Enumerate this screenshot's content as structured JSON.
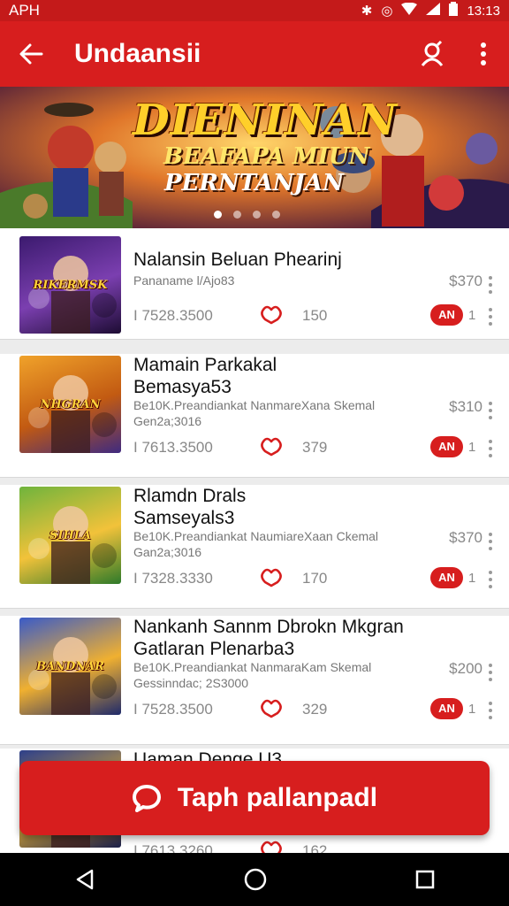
{
  "status_bar": {
    "left_text": "APH",
    "time": "13:13"
  },
  "app_bar": {
    "title": "Undaansii"
  },
  "banner": {
    "line1": "DIENINAN",
    "line2": "BEAFAPA MIUN",
    "line3": "PERNTANJAN",
    "slides": 4,
    "active_slide": 0
  },
  "cards": [
    {
      "title": "Nalansin Beluan Phearinj",
      "title2": "",
      "subtitle": "Pananame l/Ajo83",
      "subtitle2": "",
      "price": "$370",
      "id": "I 7528.3500",
      "count": "150",
      "pill": "AN",
      "badge_num": "1",
      "thumb_label": "RIKERMSK",
      "thumb_colors": [
        "#3b1a6e",
        "#7b3fb0",
        "#1d0c33"
      ]
    },
    {
      "title": "Mamain Parkakal",
      "title2": "Bemasya53",
      "subtitle": "Be10K.Preandiankat NanmareXana Skemal",
      "subtitle2": "Gen2a;3016",
      "price": "$310",
      "id": "I 7613.3500",
      "count": "379",
      "pill": "AN",
      "badge_num": "1",
      "thumb_label": "NHGRAN",
      "thumb_colors": [
        "#f0a22a",
        "#c25a12",
        "#3f2a80"
      ]
    },
    {
      "title": "Rlamdn Drals",
      "title2": "Samseyals3",
      "subtitle": "Be10K.Preandiankat NaumiareXaan Ckemal",
      "subtitle2": "Gan2a;3016",
      "price": "$370",
      "id": "I 7328.3330",
      "count": "170",
      "pill": "AN",
      "badge_num": "1",
      "thumb_label": "SIHLA",
      "thumb_colors": [
        "#6fb43c",
        "#f2c23a",
        "#2e7a2a"
      ]
    },
    {
      "title": "Nankanh Sannm Dbrokn Mkgran",
      "title2": "Gatlaran Plenarba3",
      "subtitle": "Be10K.Preandiankat NanmaraKam Skemal",
      "subtitle2": "Gessinndac; 2S3000",
      "price": "$200",
      "id": "I 7528.3500",
      "count": "329",
      "pill": "AN",
      "badge_num": "1",
      "thumb_label": "BANDNAR",
      "thumb_colors": [
        "#3a5bc8",
        "#f0b030",
        "#1f2a6a"
      ]
    },
    {
      "title": "Uaman Denge U3",
      "title2": "",
      "subtitle": "",
      "subtitle2": "",
      "price": "",
      "id": "I 7613.3260",
      "count": "162",
      "pill": "",
      "badge_num": "",
      "thumb_label": "",
      "thumb_colors": [
        "#2d3f8a",
        "#d4a63a",
        "#1a1f4a"
      ]
    }
  ],
  "fab": {
    "label": "Taph pallanpadl"
  },
  "colors": {
    "primary": "#d71e1e",
    "status": "#c41a1a"
  }
}
